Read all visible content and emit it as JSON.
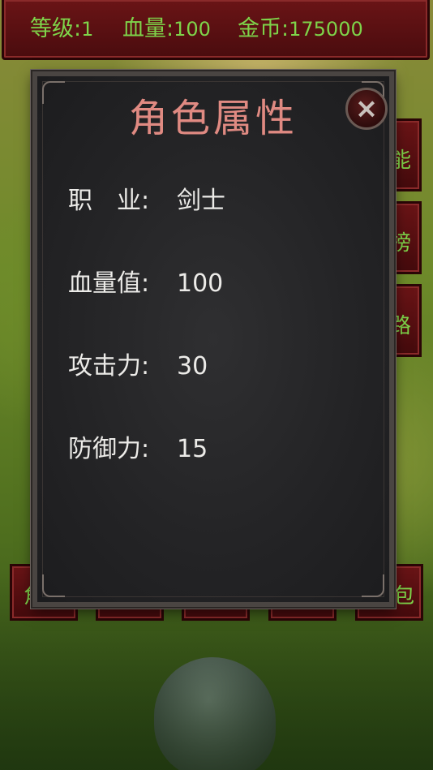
{
  "topbar": {
    "level_label": "等级:",
    "level_value": "1",
    "hp_label": "血量:",
    "hp_value": "100",
    "gold_label": "金币:",
    "gold_value": "175000"
  },
  "side_buttons": [
    "能",
    "榜",
    "路"
  ],
  "bottom_buttons": [
    "角",
    "",
    "",
    "",
    "包"
  ],
  "dialog": {
    "title": "角色属性",
    "close_icon": "×",
    "attributes": [
      {
        "label": "职　业:",
        "value": "剑士"
      },
      {
        "label": "血量值:",
        "value": "100"
      },
      {
        "label": "攻击力:",
        "value": "30"
      },
      {
        "label": "防御力:",
        "value": "15"
      }
    ]
  },
  "colors": {
    "accent_green": "#7ed44a",
    "title_pink": "#e08a82",
    "bar_red": "#5a1012"
  }
}
